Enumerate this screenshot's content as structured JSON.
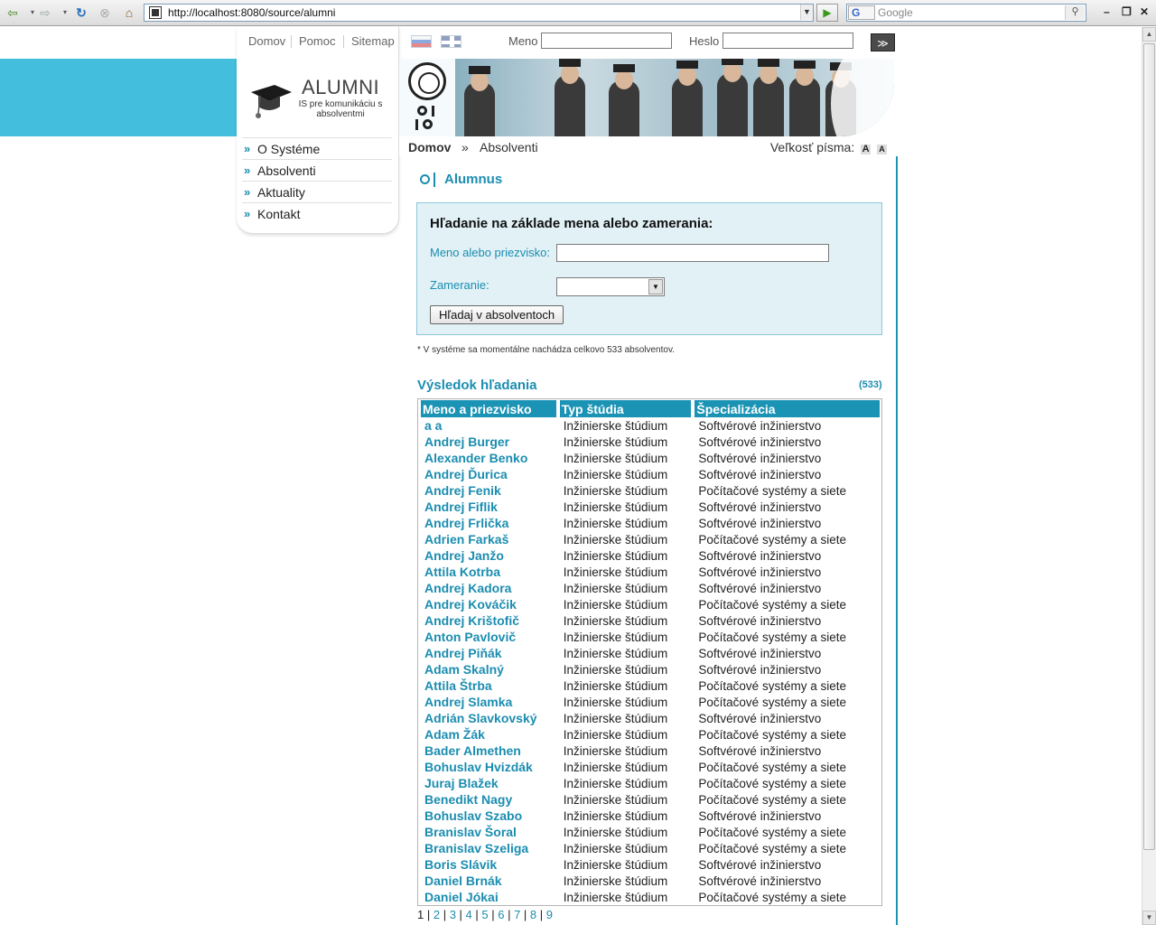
{
  "browser": {
    "url": "http://localhost:8080/source/alumni",
    "search_placeholder": "Google",
    "search_engine_logo": "G"
  },
  "topnav": [
    "Domov",
    "Pomoc",
    "Sitemap"
  ],
  "login": {
    "name_label": "Meno",
    "password_label": "Heslo",
    "submit_glyph": "≫"
  },
  "logo": {
    "title": "ALUMNI",
    "subtitle": "IS pre komunikáciu s absolventmi"
  },
  "menu": [
    "O Systéme",
    "Absolventi",
    "Aktuality",
    "Kontakt"
  ],
  "breadcrumb": {
    "home": "Domov",
    "separator": "»",
    "current": "Absolventi"
  },
  "font_size": {
    "label": "Veľkosť písma:",
    "large": "A",
    "small": "A"
  },
  "page_title": "Alumnus",
  "search": {
    "heading": "Hľadanie na základe mena alebo zamerania:",
    "name_label": "Meno alebo priezvisko:",
    "name_value": "",
    "focus_label": "Zameranie:",
    "focus_value": "",
    "button": "Hľadaj v absolventoch"
  },
  "note": "* V systéme sa momentálne nachádza celkovo 533 absolventov.",
  "results": {
    "title": "Výsledok hľadania",
    "count": "(533)",
    "columns": [
      "Meno a priezvisko",
      "Typ štúdia",
      "Špecializácia"
    ],
    "rows": [
      [
        "a a",
        "Inžinierske štúdium",
        "Softvérové inžinierstvo"
      ],
      [
        "Andrej Burger",
        "Inžinierske štúdium",
        "Softvérové inžinierstvo"
      ],
      [
        "Alexander Benko",
        "Inžinierske štúdium",
        "Softvérové inžinierstvo"
      ],
      [
        "Andrej Ďurica",
        "Inžinierske štúdium",
        "Softvérové inžinierstvo"
      ],
      [
        "Andrej Fenik",
        "Inžinierske štúdium",
        "Počítačové systémy a siete"
      ],
      [
        "Andrej Fiflik",
        "Inžinierske štúdium",
        "Softvérové inžinierstvo"
      ],
      [
        "Andrej Frlička",
        "Inžinierske štúdium",
        "Softvérové inžinierstvo"
      ],
      [
        "Adrien Farkaš",
        "Inžinierske štúdium",
        "Počítačové systémy a siete"
      ],
      [
        "Andrej Janžo",
        "Inžinierske štúdium",
        "Softvérové inžinierstvo"
      ],
      [
        "Attila Kotrba",
        "Inžinierske štúdium",
        "Softvérové inžinierstvo"
      ],
      [
        "Andrej Kadora",
        "Inžinierske štúdium",
        "Softvérové inžinierstvo"
      ],
      [
        "Andrej Kováčik",
        "Inžinierske štúdium",
        "Počítačové systémy a siete"
      ],
      [
        "Andrej Krištofič",
        "Inžinierske štúdium",
        "Softvérové inžinierstvo"
      ],
      [
        "Anton Pavlovič",
        "Inžinierske štúdium",
        "Počítačové systémy a siete"
      ],
      [
        "Andrej Piňák",
        "Inžinierske štúdium",
        "Softvérové inžinierstvo"
      ],
      [
        "Adam Skalný",
        "Inžinierske štúdium",
        "Softvérové inžinierstvo"
      ],
      [
        "Attila Štrba",
        "Inžinierske štúdium",
        "Počítačové systémy a siete"
      ],
      [
        "Andrej Slamka",
        "Inžinierske štúdium",
        "Počítačové systémy a siete"
      ],
      [
        "Adrián Slavkovský",
        "Inžinierske štúdium",
        "Softvérové inžinierstvo"
      ],
      [
        "Adam Žák",
        "Inžinierske štúdium",
        "Počítačové systémy a siete"
      ],
      [
        "Bader Almethen",
        "Inžinierske štúdium",
        "Softvérové inžinierstvo"
      ],
      [
        "Bohuslav Hvizdák",
        "Inžinierske štúdium",
        "Počítačové systémy a siete"
      ],
      [
        "Juraj Blažek",
        "Inžinierske štúdium",
        "Počítačové systémy a siete"
      ],
      [
        "Benedikt Nagy",
        "Inžinierske štúdium",
        "Počítačové systémy a siete"
      ],
      [
        "Bohuslav Szabo",
        "Inžinierske štúdium",
        "Softvérové inžinierstvo"
      ],
      [
        "Branislav Šoral",
        "Inžinierske štúdium",
        "Počítačové systémy a siete"
      ],
      [
        "Branislav Szeliga",
        "Inžinierske štúdium",
        "Počítačové systémy a siete"
      ],
      [
        "Boris Slávik",
        "Inžinierske štúdium",
        "Softvérové inžinierstvo"
      ],
      [
        "Daniel Brnák",
        "Inžinierske štúdium",
        "Softvérové inžinierstvo"
      ],
      [
        "Daniel Jókai",
        "Inžinierske štúdium",
        "Počítačové systémy a siete"
      ]
    ]
  },
  "pager": {
    "current": "1",
    "pages": [
      "2",
      "3",
      "4",
      "5",
      "6",
      "7",
      "8",
      "9"
    ]
  },
  "colors": {
    "accent": "#1b8db0",
    "band": "#43bedc",
    "search_bg": "#e1f1f6"
  }
}
